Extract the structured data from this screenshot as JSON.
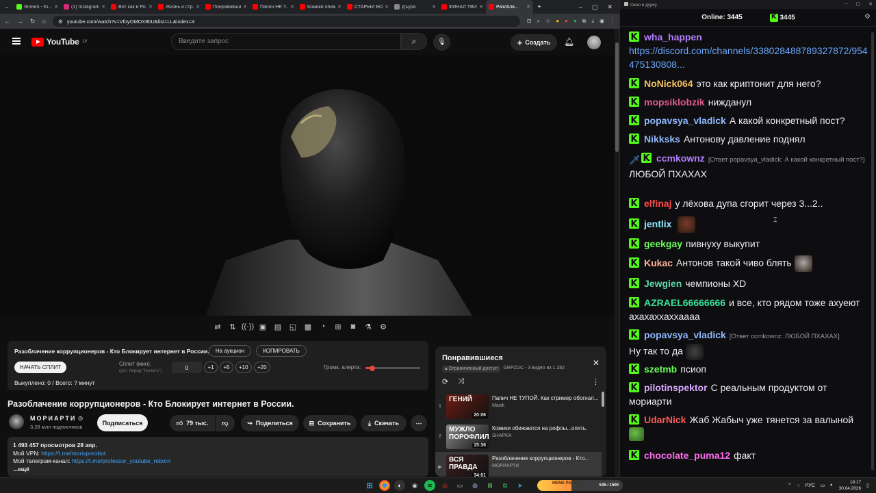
{
  "browser": {
    "tabs": [
      {
        "label": "Stream - Ki...",
        "color": "#53fc18"
      },
      {
        "label": "(1) Instagram",
        "color": "#d62976"
      },
      {
        "label": "Вот как в Ро...",
        "color": "#ff0000"
      },
      {
        "label": "Жизнь и стр...",
        "color": "#ff0000"
      },
      {
        "label": "Понравивши...",
        "color": "#ff0000"
      },
      {
        "label": "Папич НЕ Т...",
        "color": "#ff0000"
      },
      {
        "label": "Комики обиж...",
        "color": "#ff0000"
      },
      {
        "label": "СТАРЫЙ БО...",
        "color": "#ff0000"
      },
      {
        "label": "Дъура",
        "color": "#888888"
      },
      {
        "label": "ФИНАЛ ТВИ...",
        "color": "#ff0000"
      },
      {
        "label": "Разобла...",
        "color": "#ff0000",
        "active": true
      }
    ],
    "url": "youtube.com/watch?v=VfoyOMDX9bU&list=LL&index=4"
  },
  "youtube": {
    "logo_text": "YouTube",
    "region": "LV",
    "search_placeholder": "Введите запрос",
    "create_label": "Создать"
  },
  "split_panel": {
    "title": "Разоблачение коррупционеров - Кто Блокирует интернет в России.",
    "auction_label": "На аукцион",
    "copy_label": "КОПИРОВАТЬ",
    "start_label": "НАЧАТЬ СПЛИТ",
    "split_label": "Сплит (мин):",
    "split_hint": "(уст. перед \"Начать\")",
    "split_value": "0",
    "increments": [
      "+1",
      "+5",
      "+10",
      "+20"
    ],
    "volume_label": "Громк. алерта:",
    "volume_level": 0.12,
    "done_text": "Выкуплено: 0 / Всего: ? минут"
  },
  "video": {
    "title": "Разоблачение коррупционеров - Кто Блокирует интернет в России.",
    "channel": "МОРИАРТИ",
    "subscribers": "3,28 млн подписчиков",
    "subscribe_label": "Подписаться",
    "likes": "79 тыс.",
    "share_label": "Поделиться",
    "save_label": "Сохранить",
    "download_label": "Скачать",
    "views_date": "1 493 457 просмотров  28 апр.",
    "vpn_label": "Мой VPN: ",
    "vpn_link": "https://t.me/morivpnrobot",
    "tg_label": "Мой телеграм-канал: ",
    "tg_link": "https://t.me/professor_youtube_reborn",
    "more_label": "...ещё"
  },
  "playlist": {
    "title": "Понравившиеся",
    "access": "Ограниченный доступ",
    "meta": "GRPZDC - 3 видео из 1 282",
    "items": [
      {
        "index": "1",
        "title": "Папич НЕ ТУПОЙ. Как стример обогнал...",
        "channel": "Masik",
        "duration": "20:06",
        "thumb_text": "ГЕНИЙ",
        "thumb_color": "#6b1d12"
      },
      {
        "index": "2",
        "title": "Комики обижаются на рофлы...опять.",
        "channel": "SHAPKA",
        "duration": "15:36",
        "thumb_text": "МУЖЛО ПОРОФЛИЛ",
        "thumb_color": "#8a8a8a"
      },
      {
        "index": "▶",
        "title": "Разоблачение коррупционеров - Кто...",
        "channel": "МОРИАРТИ",
        "duration": "34:01",
        "thumb_text": "ВСЯ ПРАВДА",
        "thumb_color": "#3a1e1e",
        "active": true
      }
    ]
  },
  "chat": {
    "window_title": "Окно в дурку",
    "online_label": "Online:",
    "online_count": "3445",
    "viewers": "3445",
    "messages": [
      {
        "nick": "wha_happen",
        "color": "#b47dff",
        "text": "",
        "link": "https://discord.com/channels/338028488789327872/954475130808..."
      },
      {
        "nick": "NoNick064",
        "color": "#f5c35b",
        "text": "это как криптонит для него?"
      },
      {
        "nick": "mopsiklobzik",
        "color": "#e05b8c",
        "text": "нижданул"
      },
      {
        "nick": "popavsya_vladick",
        "color": "#8fb8ff",
        "text": "А какой конкретный пост?"
      },
      {
        "nick": "Nikksks",
        "color": "#8fb8ff",
        "text": "Антонову давление поднял"
      },
      {
        "nick": "ccmkownz",
        "color": "#b47dff",
        "reply": "[Ответ popavsya_vladick: А какой конкретный пост?]",
        "text": "ЛЮБОЙ ПХАХАХ"
      },
      {
        "nick": "elfinaj",
        "color": "#ff4a4a",
        "text": "у лёхова дупа сгорит через 3...2.."
      },
      {
        "nick": "jentlix",
        "color": "#8fe6ff",
        "text": ""
      },
      {
        "nick": "geekgay",
        "color": "#6bff5a",
        "text": "пивнуху выкупит"
      },
      {
        "nick": "Kukac",
        "color": "#ffb199",
        "text": "Антонов такой чиво блять"
      },
      {
        "nick": "Jewgien",
        "color": "#5fd6a8",
        "text": "чемпионы XD"
      },
      {
        "nick": "AZRAEL66666666",
        "color": "#3be39a",
        "text": "и все, кто рядом тоже ахуеют ахахаххаххаааа"
      },
      {
        "nick": "popavsya_vladick",
        "color": "#8fb8ff",
        "reply": "[Ответ ccmkownz: ЛЮБОЙ ПХАХАХ]",
        "text": "Ну так то да"
      },
      {
        "nick": "szetmb",
        "color": "#6bff5a",
        "text": "псиоп"
      },
      {
        "nick": "pilotinspektor",
        "color": "#d9a6ff",
        "text": "С реальным продуктом от мориарти"
      },
      {
        "nick": "UdarNick",
        "color": "#ff5a5a",
        "text": "Жаб Жабыч уже тянется за валыной"
      },
      {
        "nick": "chocolate_puma12",
        "color": "#ff6cf0",
        "text": "факт"
      }
    ]
  },
  "taskbar": {
    "meme_label": "MEME PARTY",
    "meme_count": "535 / 1500",
    "lang": "РУС",
    "time": "18:17",
    "date": "30.04.2026"
  }
}
